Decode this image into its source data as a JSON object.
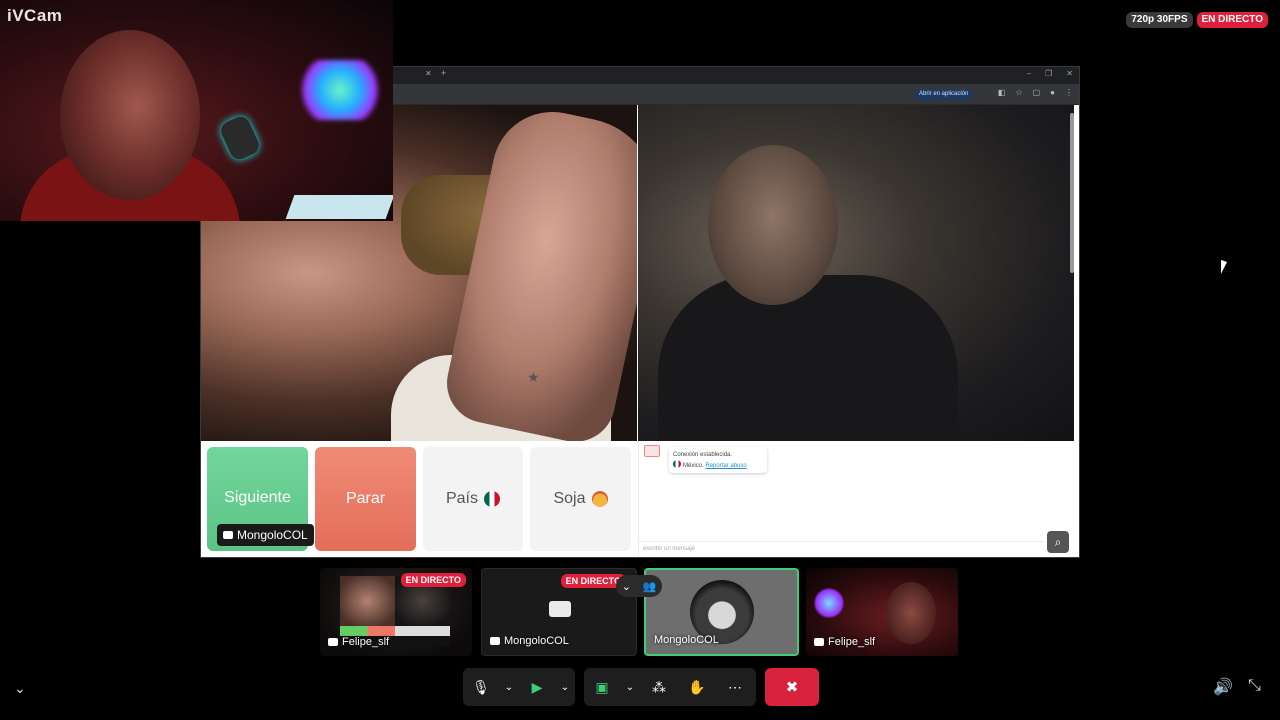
{
  "app": {
    "brand": "iVCam"
  },
  "status": {
    "resolution": "720p 30FPS",
    "live": "EN DIRECTO"
  },
  "browser": {
    "open_in_app": "Abrir en aplicación",
    "controls": {
      "next": "Siguiente",
      "stop": "Parar",
      "country": "País",
      "gender": "Soja"
    },
    "partner_tag": "MongoloCOL",
    "chat": {
      "system_message": "Conexión establecida.",
      "country": "México",
      "report": "Reportar abuso",
      "input_placeholder": "escribir un mensaje"
    }
  },
  "participants": [
    {
      "name": "Felipe_slf",
      "badge": "EN DIRECTO"
    },
    {
      "name": "MongoloCOL",
      "badge": "EN DIRECTO"
    },
    {
      "name": "MongoloCOL"
    },
    {
      "name": "Felipe_slf"
    }
  ],
  "icons": {
    "mic": "microphone-icon",
    "camera": "camera-icon",
    "share": "screen-share-icon",
    "apps": "apps-icon",
    "raise_hand": "raise-hand-icon",
    "more": "more-icon",
    "end": "end-call-icon",
    "volume": "volume-icon",
    "exit_fullscreen": "exit-fullscreen-icon"
  },
  "colors": {
    "live": "#e0203a",
    "next": "#5bc286",
    "stop": "#e36e5a",
    "end": "#d9233c",
    "active": "#3ccf7a"
  }
}
